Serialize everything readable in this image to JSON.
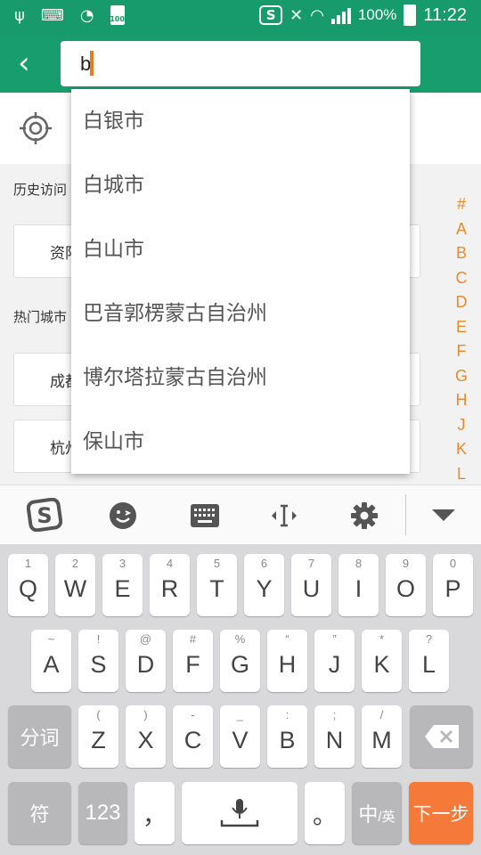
{
  "status_bar": {
    "battery_small_label": "100",
    "battery_percent": "100%",
    "time": "11:22"
  },
  "search": {
    "value": "b"
  },
  "page": {
    "history_label": "历史访问",
    "history_city": "资阳",
    "hot_label": "热门城市",
    "hot_cities": [
      "成都",
      "杭州"
    ]
  },
  "index_letters": [
    "#",
    "A",
    "B",
    "C",
    "D",
    "E",
    "F",
    "G",
    "H",
    "J",
    "K",
    "L"
  ],
  "suggestions": [
    "白银市",
    "白城市",
    "白山市",
    "巴音郭楞蒙古自治州",
    "博尔塔拉蒙古自治州",
    "保山市"
  ],
  "keyboard": {
    "row1": [
      {
        "hint": "1",
        "key": "Q"
      },
      {
        "hint": "2",
        "key": "W"
      },
      {
        "hint": "3",
        "key": "E"
      },
      {
        "hint": "4",
        "key": "R"
      },
      {
        "hint": "5",
        "key": "T"
      },
      {
        "hint": "6",
        "key": "Y"
      },
      {
        "hint": "7",
        "key": "U"
      },
      {
        "hint": "8",
        "key": "I"
      },
      {
        "hint": "9",
        "key": "O"
      },
      {
        "hint": "0",
        "key": "P"
      }
    ],
    "row2": [
      {
        "hint": "~",
        "key": "A"
      },
      {
        "hint": "!",
        "key": "S"
      },
      {
        "hint": "@",
        "key": "D"
      },
      {
        "hint": "#",
        "key": "F"
      },
      {
        "hint": "%",
        "key": "G"
      },
      {
        "hint": "“",
        "key": "H"
      },
      {
        "hint": "”",
        "key": "J"
      },
      {
        "hint": "*",
        "key": "K"
      },
      {
        "hint": "?",
        "key": "L"
      }
    ],
    "row3": [
      {
        "hint": "(",
        "key": "Z"
      },
      {
        "hint": ")",
        "key": "X"
      },
      {
        "hint": "-",
        "key": "C"
      },
      {
        "hint": "_",
        "key": "V"
      },
      {
        "hint": ":",
        "key": "B"
      },
      {
        "hint": ";",
        "key": "N"
      },
      {
        "hint": "/",
        "key": "M"
      }
    ],
    "fenci": "分词",
    "fu": "符",
    "num": "123",
    "comma": "，",
    "period": "。",
    "lang_zh": "中",
    "lang_en": "/英",
    "next": "下一步"
  },
  "colors": {
    "header_green": "#189e6e",
    "index_orange": "#e88a2d",
    "next_orange": "#f57a3a"
  }
}
